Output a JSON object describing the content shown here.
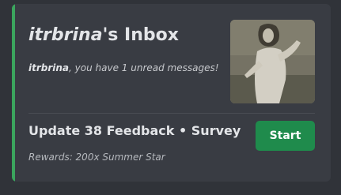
{
  "inbox": {
    "username": "itrbrina",
    "title_suffix": "'s Inbox",
    "message_suffix": ", you have 1 unread messages!",
    "thumbnail_icon": "vintage-photo-person"
  },
  "quest": {
    "title": "Update 38 Feedback • Survey",
    "rewards": "Rewards: 200x Summer Star",
    "start_label": "Start"
  },
  "colors": {
    "accent": "#3ba55d",
    "card_background": "#393c43",
    "page_background": "#303339",
    "button": "#1f8b4c"
  }
}
